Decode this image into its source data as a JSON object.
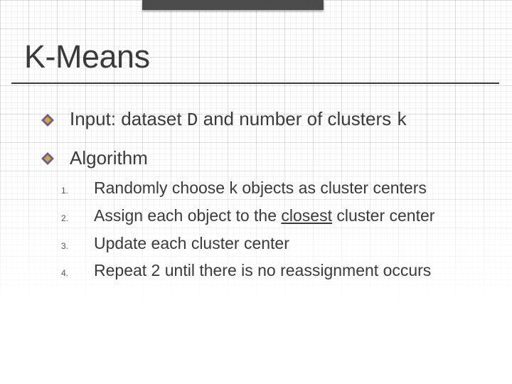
{
  "title": "K-Means",
  "bullets": [
    {
      "pre": "Input: dataset ",
      "code1": "D",
      "mid": " and number of clusters ",
      "code2": "k"
    },
    {
      "text": "Algorithm"
    }
  ],
  "steps": [
    {
      "num": "1.",
      "text": "Randomly choose k objects as cluster centers"
    },
    {
      "num": "2.",
      "pre": "Assign each object to the ",
      "underlined": "closest",
      "post": " cluster center"
    },
    {
      "num": "3.",
      "text": "Update each cluster center"
    },
    {
      "num": "4.",
      "text": "Repeat 2 until there is no reassignment occurs"
    }
  ],
  "colors": {
    "diamond_outer": "#6b6190",
    "diamond_inner": "#d9a23a"
  }
}
